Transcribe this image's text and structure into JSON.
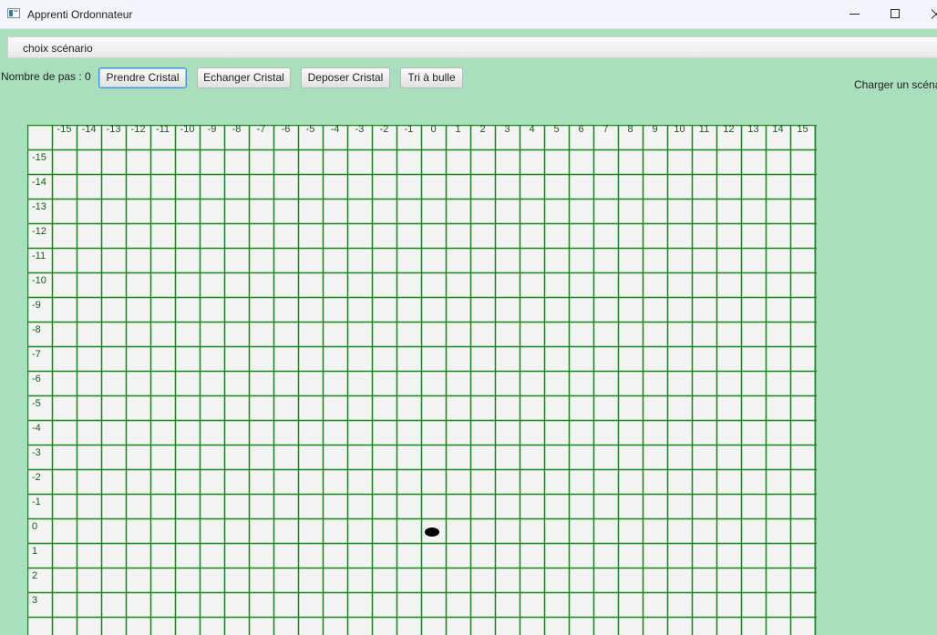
{
  "window": {
    "title": "Apprenti Ordonnateur",
    "controls": [
      "minimize-icon",
      "maximize-icon",
      "close-icon"
    ]
  },
  "menu": {
    "items": [
      {
        "label": "choix scénario"
      }
    ]
  },
  "toolbar": {
    "steps_label": "Nombre de pas : 0",
    "buttons": [
      {
        "label": "Prendre Cristal",
        "focused": true
      },
      {
        "label": "Echanger Cristal"
      },
      {
        "label": "Deposer Cristal"
      },
      {
        "label": "Tri à bulle"
      }
    ],
    "load_label": "Charger un scénario"
  },
  "grid": {
    "columns": [
      "-15",
      "-14",
      "-13",
      "-12",
      "-11",
      "-10",
      "-9",
      "-8",
      "-7",
      "-6",
      "-5",
      "-4",
      "-3",
      "-2",
      "-1",
      "0",
      "1",
      "2",
      "3",
      "4",
      "5",
      "6",
      "7",
      "8",
      "9",
      "10",
      "11",
      "12",
      "13",
      "14",
      "15"
    ],
    "rows": [
      "-15",
      "-14",
      "-13",
      "-12",
      "-11",
      "-10",
      "-9",
      "-8",
      "-7",
      "-6",
      "-5",
      "-4",
      "-3",
      "-2",
      "-1",
      "0",
      "1",
      "2",
      "3"
    ],
    "robot": {
      "x": 0,
      "y": 0
    },
    "line_color": "#17861b",
    "cell_color": "#f4f4f4"
  }
}
